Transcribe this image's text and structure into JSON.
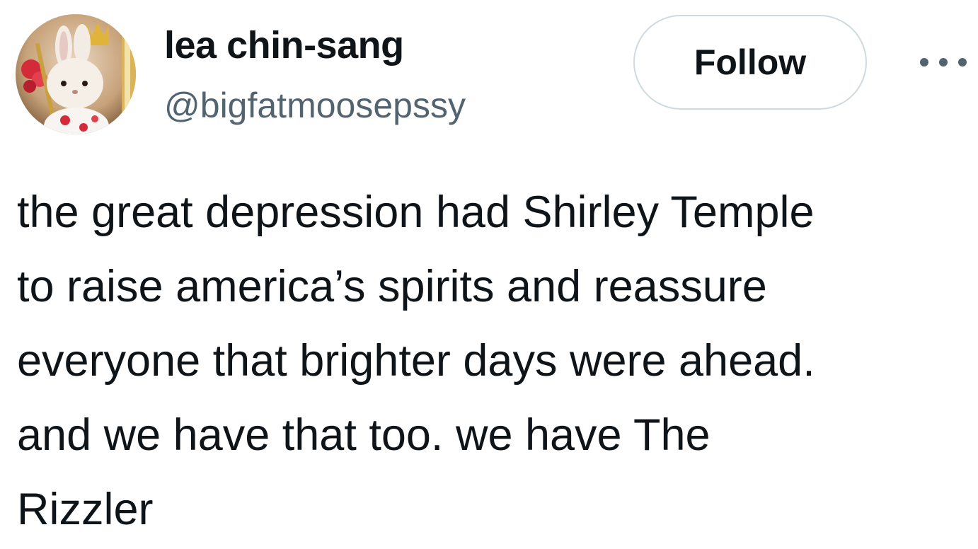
{
  "author": {
    "display_name": "lea chin-sang",
    "handle": "@bigfatmoosepssy",
    "avatar_icon": "bunny-figurine-avatar"
  },
  "actions": {
    "follow_label": "Follow",
    "more_icon": "more-horizontal-icon"
  },
  "tweet": {
    "lines": [
      "the great depression had Shirley Temple",
      "to raise america’s spirits and reassure",
      "everyone that brighter days were ahead.",
      "and we have that too. we have The",
      "Rizzler"
    ]
  },
  "colors": {
    "text_primary": "#0f1419",
    "text_secondary": "#536471",
    "button_border": "#cfd9de",
    "background": "#ffffff"
  }
}
